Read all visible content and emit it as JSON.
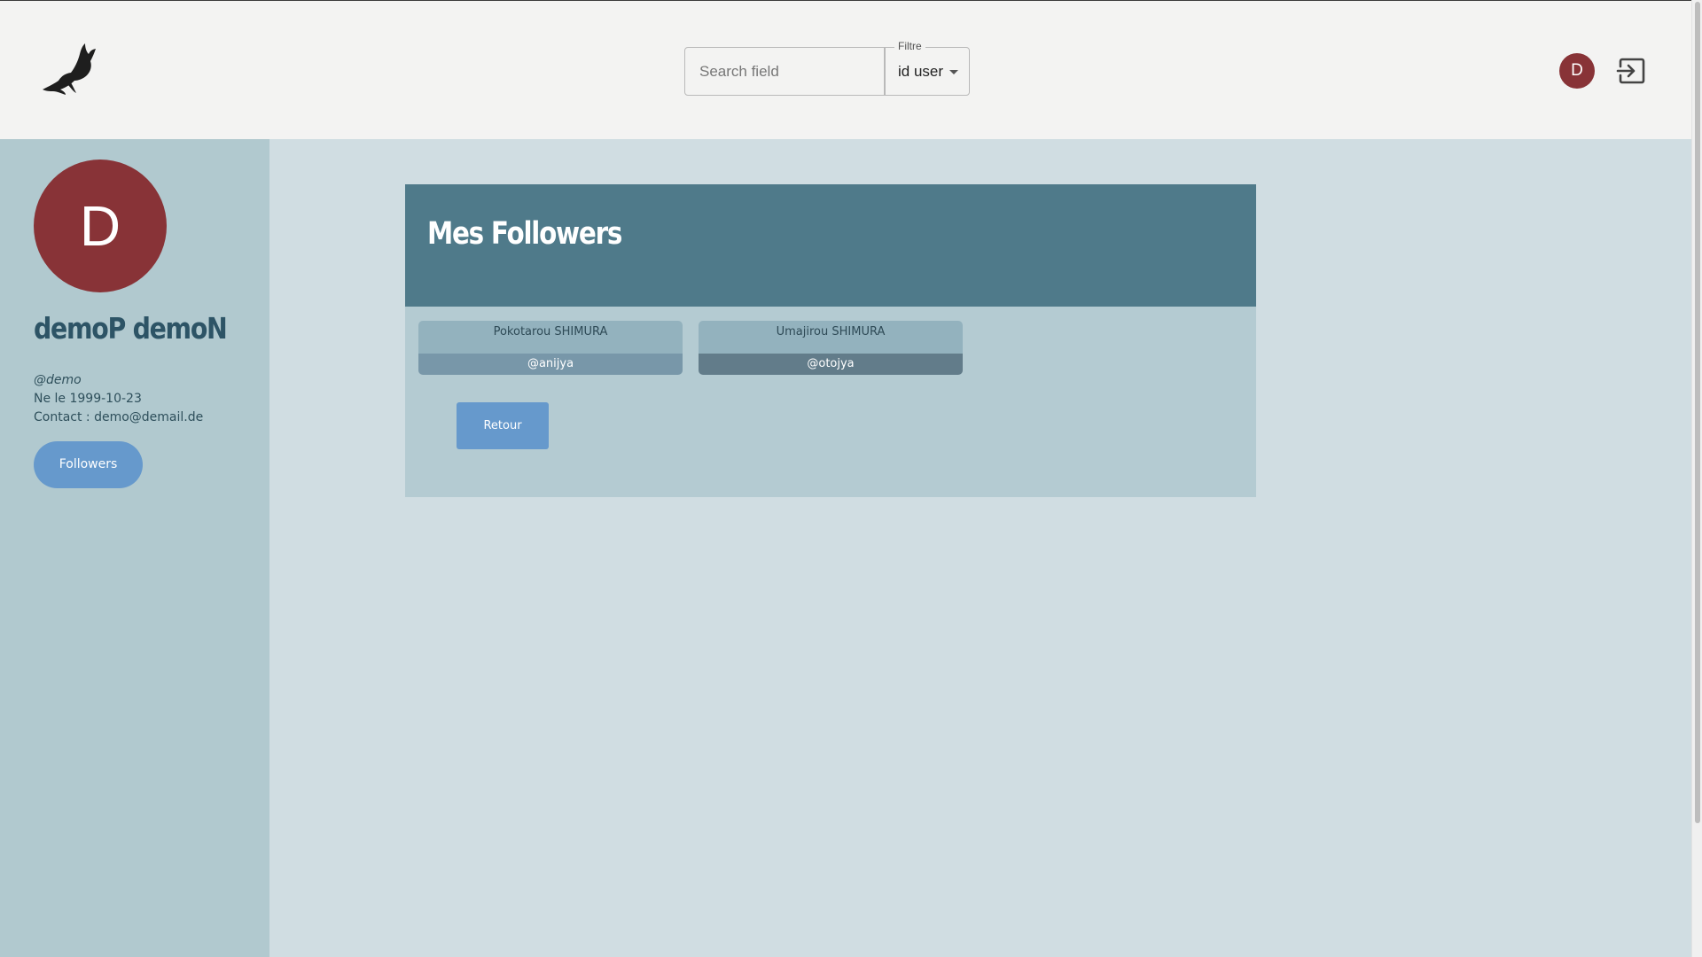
{
  "header": {
    "logo_icon": "eagle-icon",
    "search": {
      "placeholder": "Search field",
      "value": ""
    },
    "filter": {
      "legend": "Filtre",
      "selected": "id user"
    },
    "avatar_letter": "D",
    "logout_icon": "logout-icon"
  },
  "sidebar": {
    "avatar_letter": "D",
    "name": "demoP demoN",
    "handle": "@demo",
    "born": "Ne le 1999-10-23",
    "contact": "Contact : demo@demail.de",
    "followers_button": "Followers"
  },
  "main": {
    "title": "Mes Followers",
    "followers": [
      {
        "first_name": "Pokotarou",
        "last_name": "SHIMURA",
        "handle": "@anijya"
      },
      {
        "first_name": "Umajirou",
        "last_name": "SHIMURA",
        "handle": "@otojya"
      }
    ],
    "back_button": "Retour"
  },
  "colors": {
    "header_bg": "#f3f3f2",
    "sidebar_bg": "#b1c9cf",
    "content_bg": "#d0dde2",
    "panel_header": "#4f7a8a",
    "avatar": "#883337",
    "accent_button": "#6699cc"
  }
}
